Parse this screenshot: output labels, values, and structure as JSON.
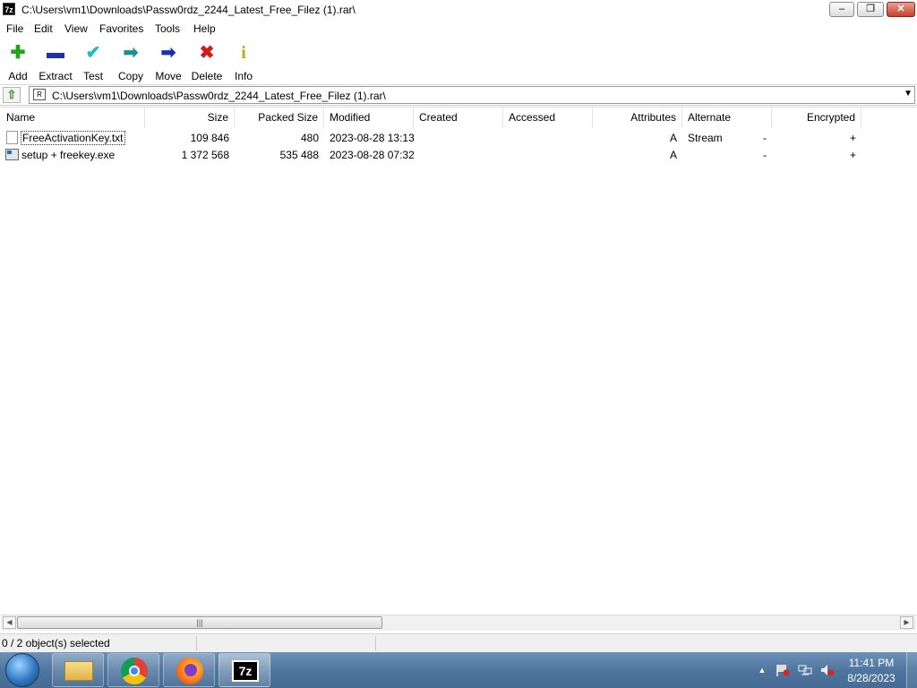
{
  "window": {
    "icon_text": "7z",
    "title": "C:\\Users\\vm1\\Downloads\\Passw0rdz_2244_Latest_Free_Filez (1).rar\\",
    "minimize_glyph": "‒",
    "maximize_glyph": "❐",
    "close_glyph": "✕"
  },
  "menu": [
    "File",
    "Edit",
    "View",
    "Favorites",
    "Tools",
    "Help"
  ],
  "toolbar": [
    {
      "label": "Add",
      "icon": "plus-icon",
      "glyph": "✚",
      "color": "#1fa51f"
    },
    {
      "label": "Extract",
      "icon": "minus-icon",
      "glyph": "▬",
      "color": "#1c2fb0"
    },
    {
      "label": "Test",
      "icon": "check-icon",
      "glyph": "✔",
      "color": "#20b8c8"
    },
    {
      "label": "Copy",
      "icon": "copy-arrow-icon",
      "glyph": "➡",
      "color": "#1f8f8a"
    },
    {
      "label": "Move",
      "icon": "move-arrow-icon",
      "glyph": "➡",
      "color": "#1c2fb0"
    },
    {
      "label": "Delete",
      "icon": "delete-x-icon",
      "glyph": "✖",
      "color": "#d21a1a"
    },
    {
      "label": "Info",
      "icon": "info-icon",
      "glyph": "i",
      "color": "#c8a800"
    }
  ],
  "address": {
    "path": "C:\\Users\\vm1\\Downloads\\Passw0rdz_2244_Latest_Free_Filez (1).rar\\",
    "up_glyph": "⇧",
    "icon_text": "R",
    "dropdown_glyph": "▼"
  },
  "columns": [
    "Name",
    "Size",
    "Packed Size",
    "Modified",
    "Created",
    "Accessed",
    "Attributes",
    "Alternate Stream",
    "Encrypted"
  ],
  "files": [
    {
      "name": "FreeActivationKey.txt",
      "type": "text-file-icon",
      "size": "109 846",
      "packed_size": "480",
      "modified": "2023-08-28 13:13",
      "created": "",
      "accessed": "",
      "attributes": "A",
      "alternate_stream": "-",
      "encrypted": "+"
    },
    {
      "name": "setup + freekey.exe",
      "type": "executable-icon",
      "size": "1 372 568",
      "packed_size": "535 488",
      "modified": "2023-08-28 07:32",
      "created": "",
      "accessed": "",
      "attributes": "A",
      "alternate_stream": "-",
      "encrypted": "+"
    }
  ],
  "scrollbar": {
    "left_glyph": "◀",
    "right_glyph": "▶",
    "grip": "|||"
  },
  "status": {
    "selected": "0 / 2 object(s) selected"
  },
  "taskbar": {
    "apps": [
      "windows-explorer",
      "google-chrome",
      "firefox",
      "7-zip"
    ],
    "tray_arrow": "▲",
    "clock_time": "11:41 PM",
    "clock_date": "8/28/2023"
  }
}
